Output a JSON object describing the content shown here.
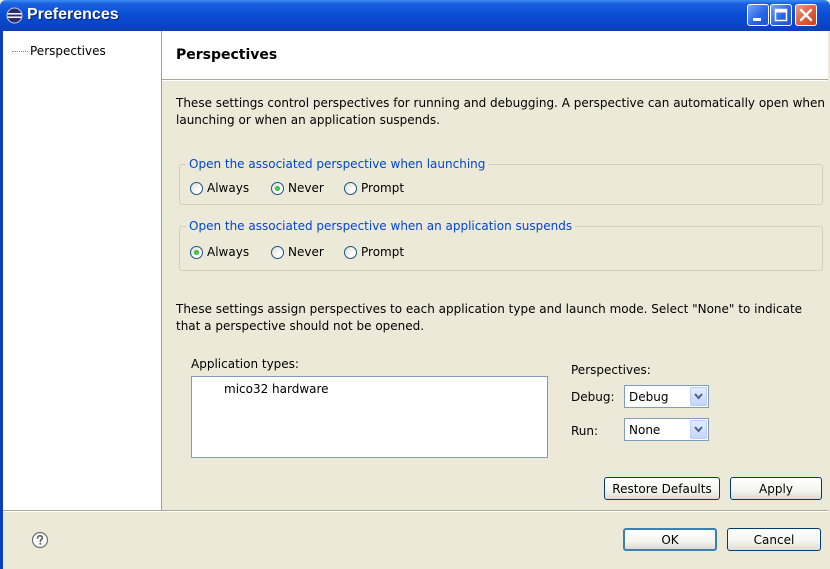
{
  "window": {
    "title": "Preferences"
  },
  "tree": {
    "items": [
      {
        "label": "Perspectives"
      }
    ]
  },
  "page": {
    "title": "Perspectives",
    "description1": "These settings control perspectives for running and debugging. A perspective can automatically open when launching or when an application suspends.",
    "launching_group": {
      "legend": "Open the associated perspective when launching",
      "options": [
        {
          "label": "Always",
          "selected": false
        },
        {
          "label": "Never",
          "selected": true
        },
        {
          "label": "Prompt",
          "selected": false
        }
      ]
    },
    "suspend_group": {
      "legend": "Open the associated perspective when an application suspends",
      "options": [
        {
          "label": "Always",
          "selected": true
        },
        {
          "label": "Never",
          "selected": false
        },
        {
          "label": "Prompt",
          "selected": false
        }
      ]
    },
    "description2": "These settings assign perspectives to each application type and launch mode. Select \"None\" to indicate that a perspective should not be opened.",
    "app_types": {
      "label": "Application types:",
      "items": [
        "mico32 hardware"
      ]
    },
    "perspectives": {
      "label": "Perspectives:",
      "debug": {
        "label": "Debug:",
        "value": "Debug"
      },
      "run": {
        "label": "Run:",
        "value": "None"
      }
    },
    "buttons": {
      "restore_defaults": "Restore Defaults",
      "apply": "Apply"
    }
  },
  "footer": {
    "ok": "OK",
    "cancel": "Cancel"
  },
  "colors": {
    "title_bar": "#0a46c8",
    "group_legend": "#0046d5",
    "selected_radio": "#21a121"
  }
}
